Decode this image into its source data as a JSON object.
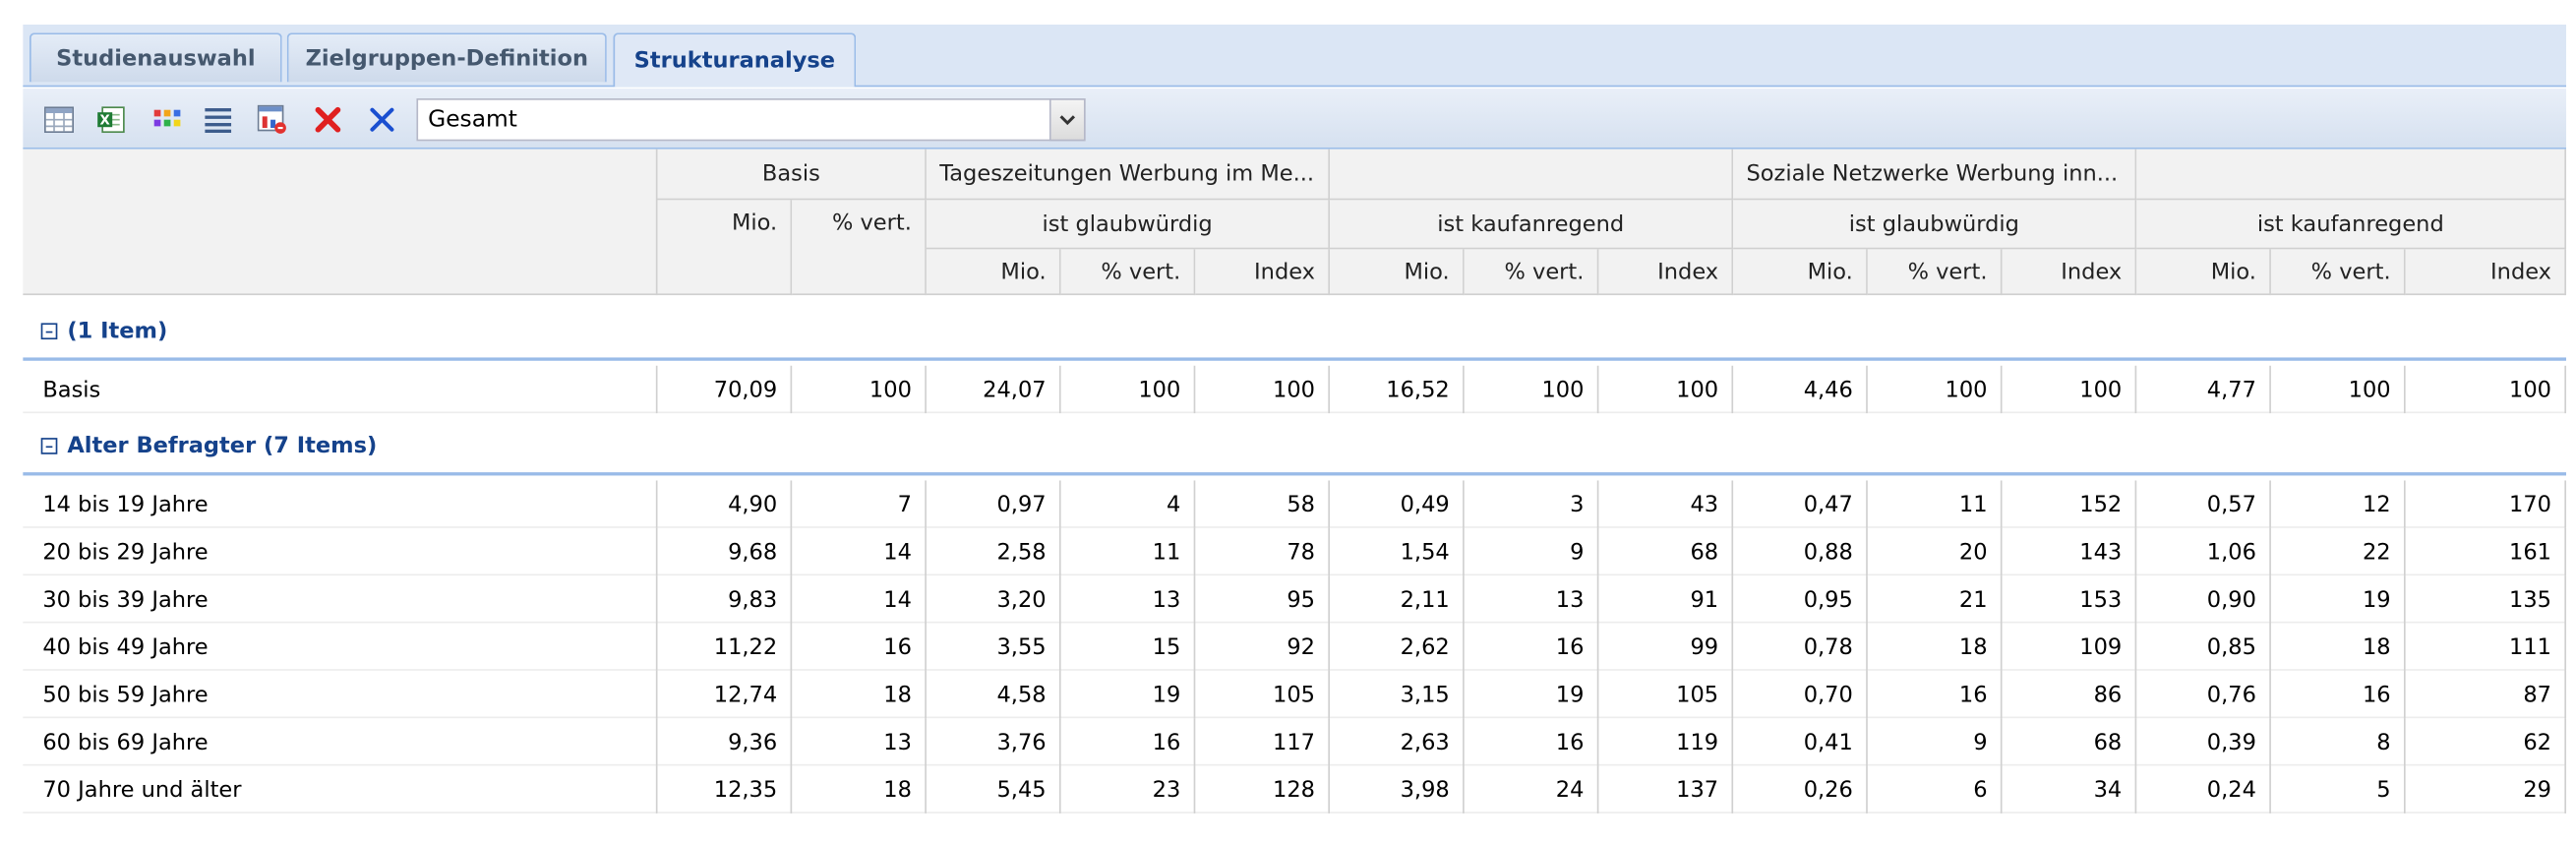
{
  "tabs": [
    {
      "label": "Studienauswahl"
    },
    {
      "label": "Zielgruppen-Definition"
    },
    {
      "label": "Strukturanalyse",
      "active": true
    }
  ],
  "toolbar": {
    "icons": [
      "table-view-icon",
      "excel-export-icon",
      "color-palette-icon",
      "list-lines-icon",
      "chart-config-icon",
      "delete-red-icon",
      "clear-blue-icon"
    ],
    "combo_value": "Gesamt"
  },
  "header": {
    "basis": "Basis",
    "group1": "Tageszeitungen Werbung im Me...",
    "group2": "",
    "group3": "Soziale Netzwerke Werbung inn...",
    "group4": "",
    "sub1": "ist glaubwürdig",
    "sub2": "ist kaufanregend",
    "sub3": "ist glaubwürdig",
    "sub4": "ist kaufanregend",
    "mio": "Mio.",
    "vert": "% vert.",
    "index": "Index"
  },
  "groups": [
    {
      "title": "(1 Item)",
      "rows": [
        {
          "label": "Basis",
          "values": [
            "70,09",
            "100",
            "24,07",
            "100",
            "100",
            "16,52",
            "100",
            "100",
            "4,46",
            "100",
            "100",
            "4,77",
            "100",
            "100"
          ]
        }
      ]
    },
    {
      "title": "Alter Befragter (7 Items)",
      "rows": [
        {
          "label": "14 bis 19 Jahre",
          "values": [
            "4,90",
            "7",
            "0,97",
            "4",
            "58",
            "0,49",
            "3",
            "43",
            "0,47",
            "11",
            "152",
            "0,57",
            "12",
            "170"
          ]
        },
        {
          "label": "20 bis 29 Jahre",
          "values": [
            "9,68",
            "14",
            "2,58",
            "11",
            "78",
            "1,54",
            "9",
            "68",
            "0,88",
            "20",
            "143",
            "1,06",
            "22",
            "161"
          ]
        },
        {
          "label": "30 bis 39 Jahre",
          "values": [
            "9,83",
            "14",
            "3,20",
            "13",
            "95",
            "2,11",
            "13",
            "91",
            "0,95",
            "21",
            "153",
            "0,90",
            "19",
            "135"
          ]
        },
        {
          "label": "40 bis 49 Jahre",
          "values": [
            "11,22",
            "16",
            "3,55",
            "15",
            "92",
            "2,62",
            "16",
            "99",
            "0,78",
            "18",
            "109",
            "0,85",
            "18",
            "111"
          ]
        },
        {
          "label": "50 bis 59 Jahre",
          "values": [
            "12,74",
            "18",
            "4,58",
            "19",
            "105",
            "3,15",
            "19",
            "105",
            "0,70",
            "16",
            "86",
            "0,76",
            "16",
            "87"
          ]
        },
        {
          "label": "60 bis 69 Jahre",
          "values": [
            "9,36",
            "13",
            "3,76",
            "16",
            "117",
            "2,63",
            "16",
            "119",
            "0,41",
            "9",
            "68",
            "0,39",
            "8",
            "62"
          ]
        },
        {
          "label": "70 Jahre und älter",
          "values": [
            "12,35",
            "18",
            "5,45",
            "23",
            "128",
            "3,98",
            "24",
            "137",
            "0,26",
            "6",
            "34",
            "0,24",
            "5",
            "29"
          ]
        }
      ]
    }
  ],
  "colors": {
    "tab_text": "#15428b",
    "header_bg": "#f2f2f2",
    "group_title": "#15428b",
    "delete_icon": "#e02020",
    "clear_icon": "#1a4fd0"
  }
}
